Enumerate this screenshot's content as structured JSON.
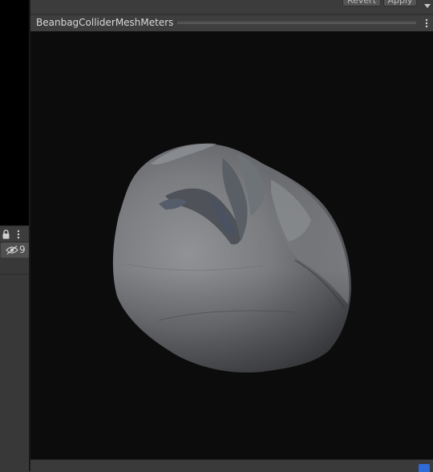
{
  "toolbar": {
    "revert_label": "Revert",
    "apply_label": "Apply"
  },
  "left_panel": {
    "hidden_count": "9",
    "icons": [
      "lock-icon",
      "kebab-menu-icon",
      "eye-slash-icon"
    ]
  },
  "preview": {
    "title": "BeanbagColliderMeshMeters",
    "icons": [
      "kebab-menu-icon"
    ]
  },
  "colors": {
    "viewport_bg": "#0c0c0c",
    "panel_bg": "#383838",
    "mesh_base": "#7f8184",
    "accent_blue": "#2e6ad8"
  }
}
